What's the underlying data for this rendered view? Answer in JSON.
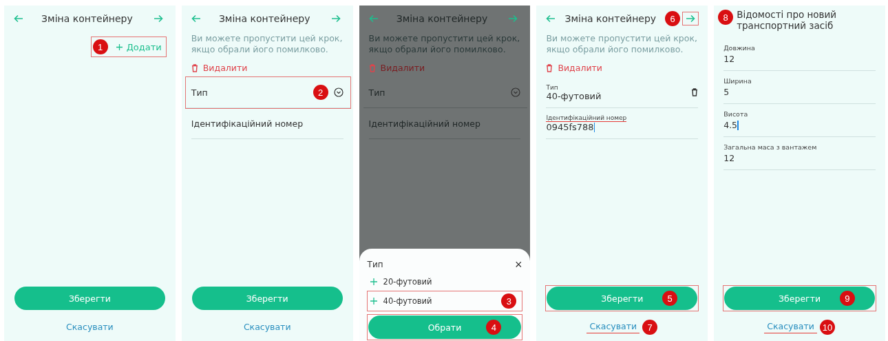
{
  "screens": [
    {
      "dimmed": false,
      "header": {
        "title": "Зміна контейнеру"
      },
      "add": {
        "label": "Додати",
        "callout": "1",
        "boxed": true
      },
      "save": {
        "label": "Зберегти"
      },
      "cancel": {
        "label": "Скасувати"
      }
    },
    {
      "dimmed": false,
      "header": {
        "title": "Зміна контейнеру"
      },
      "hint": "Ви можете пропустити цей крок, якщо обрали його помилково.",
      "delete": "Видалити",
      "fields": [
        {
          "kind": "select",
          "label": "Тип",
          "callout": "2",
          "boxed": true
        },
        {
          "kind": "text",
          "label": "Ідентифікаційний номер"
        }
      ],
      "save": {
        "label": "Зберегти"
      },
      "cancel": {
        "label": "Скасувати"
      }
    },
    {
      "dimmed": true,
      "header": {
        "title": "Зміна контейнеру"
      },
      "hint": "Ви можете пропустити цей крок, якщо обрали його помилково.",
      "delete": "Видалити",
      "fields": [
        {
          "kind": "select",
          "label": "Тип"
        },
        {
          "kind": "text",
          "label": "Ідентифікаційний номер"
        }
      ],
      "sheet": {
        "title": "Тип",
        "close": "×",
        "options": [
          {
            "label": "20-футовий"
          },
          {
            "label": "40-футовий",
            "callout": "3",
            "boxed": true
          }
        ],
        "button": {
          "label": "Обрати",
          "callout": "4",
          "boxed": true
        }
      }
    },
    {
      "dimmed": false,
      "header": {
        "title": "Зміна контейнеру",
        "forward_callout": "6",
        "forward_boxed": true
      },
      "hint": "Ви можете пропустити цей крок, якщо обрали його помилково.",
      "delete": "Видалити",
      "fields": [
        {
          "kind": "select",
          "label": "Тип",
          "value": "40-футовий"
        },
        {
          "kind": "text",
          "label": "Ідентифікаційний номер",
          "value": "0945fs788",
          "focused": true,
          "underlined": true
        }
      ],
      "save": {
        "label": "Зберегти",
        "callout": "5",
        "boxed": true
      },
      "cancel": {
        "label": "Скасувати",
        "callout": "7",
        "underlined": true
      }
    },
    {
      "dimmed": false,
      "heading": {
        "text": "Відомості про новий транспортний засіб",
        "callout": "8"
      },
      "fields": [
        {
          "kind": "text",
          "label": "Довжина",
          "value": "12"
        },
        {
          "kind": "text",
          "label": "Ширина",
          "value": "5"
        },
        {
          "kind": "text",
          "label": "Висота",
          "value": "4.5",
          "focused": true
        },
        {
          "kind": "text",
          "label": "Загальна маса з вантажем",
          "value": "12"
        }
      ],
      "save": {
        "label": "Зберегти",
        "callout": "9",
        "boxed": true
      },
      "cancel": {
        "label": "Скасувати",
        "callout": "10",
        "underlined": true
      }
    }
  ]
}
